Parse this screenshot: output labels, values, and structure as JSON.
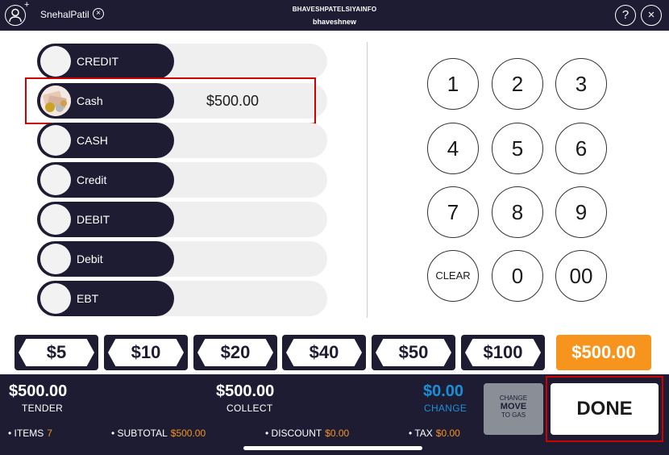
{
  "header": {
    "add_symbol": "+",
    "username": "SnehalPatil",
    "store_name": "BHAVESHPATELSIYAINFO",
    "user": "bhaveshnew",
    "help_label": "?",
    "close_label": "×",
    "small_close_label": "×"
  },
  "tenders": [
    {
      "label": "CREDIT",
      "amount": ""
    },
    {
      "label": "Cash",
      "amount": "$500.00"
    },
    {
      "label": "CASH",
      "amount": ""
    },
    {
      "label": "Credit",
      "amount": ""
    },
    {
      "label": "DEBIT",
      "amount": ""
    },
    {
      "label": "Debit",
      "amount": ""
    },
    {
      "label": "EBT",
      "amount": ""
    }
  ],
  "keypad": [
    "1",
    "2",
    "3",
    "4",
    "5",
    "6",
    "7",
    "8",
    "9",
    "CLEAR",
    "0",
    "00"
  ],
  "bills": [
    "$5",
    "$10",
    "$20",
    "$40",
    "$50",
    "$100"
  ],
  "exact_amount": "$500.00",
  "summary": {
    "tender_value": "$500.00",
    "tender_label": "TENDER",
    "collect_value": "$500.00",
    "collect_label": "COLLECT",
    "change_value": "$0.00",
    "change_label": "CHANGE"
  },
  "change_move_button": {
    "line1": "CHANGE",
    "line2": "MOVE",
    "line3": "TO GAS"
  },
  "done_label": "DONE",
  "stats": {
    "items_label": "• ITEMS",
    "items_value": "7",
    "subtotal_label": "• SUBTOTAL",
    "subtotal_value": "$500.00",
    "discount_label": "• DISCOUNT",
    "discount_value": "$0.00",
    "tax_label": "• TAX",
    "tax_value": "$0.00"
  },
  "colors": {
    "dark": "#1e1c33",
    "accent": "#f7941d",
    "change_blue": "#1a8fd6",
    "highlight": "#d00000"
  }
}
